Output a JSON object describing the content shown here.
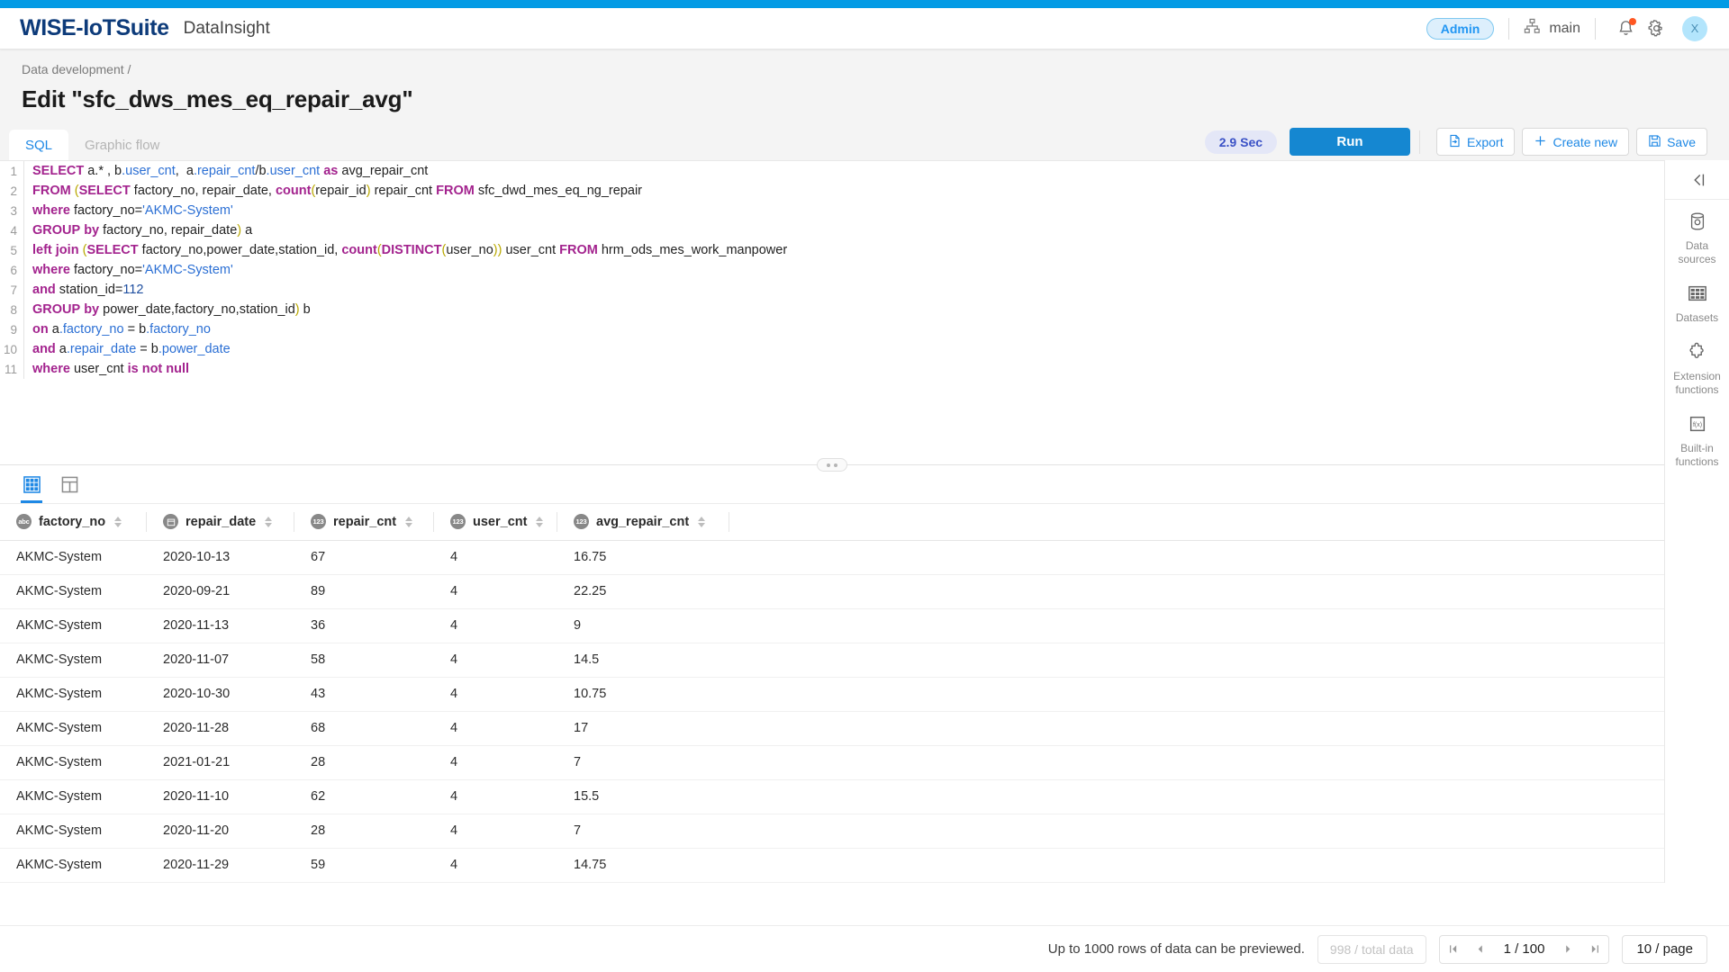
{
  "header": {
    "brand": "WISE-IoTSuite",
    "product": "DataInsight",
    "role_badge": "Admin",
    "org": "main",
    "avatar_initial": "X",
    "icons": {
      "org": "sitemap-icon",
      "notification": "bell-icon",
      "settings": "gear-icon"
    }
  },
  "breadcrumb": {
    "items": [
      "Data development"
    ],
    "separator": "/"
  },
  "page": {
    "title": "Edit \"sfc_dws_mes_eq_repair_avg\""
  },
  "tabs": [
    {
      "label": "SQL",
      "active": true
    },
    {
      "label": "Graphic flow",
      "active": false
    }
  ],
  "toolbar": {
    "duration_badge": "2.9 Sec",
    "run_label": "Run",
    "export_label": "Export",
    "create_new_label": "Create new",
    "save_label": "Save"
  },
  "editor": {
    "language": "sql",
    "line_numbers": [
      "1",
      "2",
      "3",
      "4",
      "5",
      "6",
      "7",
      "8",
      "9",
      "10",
      "11"
    ],
    "lines": [
      "SELECT a.* , b.user_cnt,  a.repair_cnt/b.user_cnt as avg_repair_cnt",
      "FROM (SELECT factory_no, repair_date, count(repair_id) repair_cnt FROM sfc_dwd_mes_eq_ng_repair",
      "where factory_no='AKMC-System'",
      "GROUP by factory_no, repair_date) a",
      "left join (SELECT factory_no,power_date,station_id, count(DISTINCT(user_no)) user_cnt FROM hrm_ods_mes_work_manpower",
      "where factory_no='AKMC-System'",
      "and station_id=112",
      "GROUP by power_date,factory_no,station_id) b",
      "on a.factory_no = b.factory_no",
      "and a.repair_date = b.power_date",
      "where user_cnt is not null"
    ]
  },
  "rail": {
    "collapse_icon": "collapse-left-icon",
    "items": [
      {
        "label": "Data sources",
        "icon": "database-icon"
      },
      {
        "label": "Datasets",
        "icon": "table-grid-icon"
      },
      {
        "label": "Extension functions",
        "icon": "puzzle-icon"
      },
      {
        "label": "Built-in functions",
        "icon": "function-icon"
      }
    ]
  },
  "results": {
    "view_toggles": [
      {
        "name": "grid-view",
        "active": true
      },
      {
        "name": "layout-view",
        "active": false
      }
    ],
    "columns": [
      {
        "name": "factory_no",
        "type": "abc"
      },
      {
        "name": "repair_date",
        "type": "date"
      },
      {
        "name": "repair_cnt",
        "type": "123"
      },
      {
        "name": "user_cnt",
        "type": "123"
      },
      {
        "name": "avg_repair_cnt",
        "type": "123"
      }
    ],
    "rows": [
      [
        "AKMC-System",
        "2020-10-13",
        "67",
        "4",
        "16.75"
      ],
      [
        "AKMC-System",
        "2020-09-21",
        "89",
        "4",
        "22.25"
      ],
      [
        "AKMC-System",
        "2020-11-13",
        "36",
        "4",
        "9"
      ],
      [
        "AKMC-System",
        "2020-11-07",
        "58",
        "4",
        "14.5"
      ],
      [
        "AKMC-System",
        "2020-10-30",
        "43",
        "4",
        "10.75"
      ],
      [
        "AKMC-System",
        "2020-11-28",
        "68",
        "4",
        "17"
      ],
      [
        "AKMC-System",
        "2021-01-21",
        "28",
        "4",
        "7"
      ],
      [
        "AKMC-System",
        "2020-11-10",
        "62",
        "4",
        "15.5"
      ],
      [
        "AKMC-System",
        "2020-11-20",
        "28",
        "4",
        "7"
      ],
      [
        "AKMC-System",
        "2020-11-29",
        "59",
        "4",
        "14.75"
      ]
    ]
  },
  "footer": {
    "note": "Up to 1000 rows of data can be previewed.",
    "total": "998 / total data",
    "page_current": "1 / 100",
    "page_size": "10 / page"
  },
  "colors": {
    "accent": "#039be5",
    "brand": "#0d3b7a",
    "primary": "#1587d1",
    "link": "#1e88e5"
  }
}
